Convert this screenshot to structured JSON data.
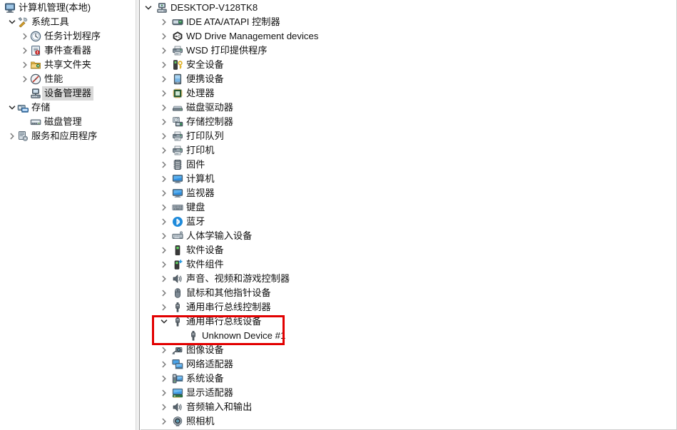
{
  "window": {
    "app": "计算机管理",
    "left_panel_name": "console-tree",
    "right_panel_name": "device-manager-tree"
  },
  "console_tree": {
    "items": [
      {
        "label": "计算机管理(本地)",
        "icon": "computer-management-icon",
        "depth": 0,
        "expander": "none",
        "selected": false
      },
      {
        "label": "系统工具",
        "icon": "system-tools-icon",
        "depth": 1,
        "expander": "expanded",
        "selected": false
      },
      {
        "label": "任务计划程序",
        "icon": "task-scheduler-clock-icon",
        "depth": 2,
        "expander": "collapsed",
        "selected": false
      },
      {
        "label": "事件查看器",
        "icon": "event-viewer-icon",
        "depth": 2,
        "expander": "collapsed",
        "selected": false
      },
      {
        "label": "共享文件夹",
        "icon": "shared-folders-icon",
        "depth": 2,
        "expander": "collapsed",
        "selected": false
      },
      {
        "label": "性能",
        "icon": "performance-gauge-icon",
        "depth": 2,
        "expander": "collapsed",
        "selected": false
      },
      {
        "label": "设备管理器",
        "icon": "device-manager-icon",
        "depth": 2,
        "expander": "none",
        "selected": true
      },
      {
        "label": "存储",
        "icon": "storage-icon",
        "depth": 1,
        "expander": "expanded",
        "selected": false
      },
      {
        "label": "磁盘管理",
        "icon": "disk-management-icon",
        "depth": 2,
        "expander": "none",
        "selected": false
      },
      {
        "label": "服务和应用程序",
        "icon": "services-and-applications-icon",
        "depth": 1,
        "expander": "collapsed",
        "selected": false
      }
    ]
  },
  "device_tree": {
    "items": [
      {
        "label": "DESKTOP-V128TK8",
        "icon": "computer-root-icon",
        "depth": 0,
        "expander": "expanded",
        "latin": true
      },
      {
        "label": "IDE ATA/ATAPI 控制器",
        "icon": "ide-controller-icon",
        "depth": 1,
        "expander": "collapsed"
      },
      {
        "label": "WD Drive Management devices",
        "icon": "wd-drive-management-icon",
        "depth": 1,
        "expander": "collapsed",
        "latin": true
      },
      {
        "label": "WSD 打印提供程序",
        "icon": "printer-icon",
        "depth": 1,
        "expander": "collapsed"
      },
      {
        "label": "安全设备",
        "icon": "security-device-key-icon",
        "depth": 1,
        "expander": "collapsed"
      },
      {
        "label": "便携设备",
        "icon": "portable-device-icon",
        "depth": 1,
        "expander": "collapsed"
      },
      {
        "label": "处理器",
        "icon": "processor-chip-icon",
        "depth": 1,
        "expander": "collapsed"
      },
      {
        "label": "磁盘驱动器",
        "icon": "disk-drive-icon",
        "depth": 1,
        "expander": "collapsed"
      },
      {
        "label": "存储控制器",
        "icon": "storage-controller-icon",
        "depth": 1,
        "expander": "collapsed"
      },
      {
        "label": "打印队列",
        "icon": "print-queue-icon",
        "depth": 1,
        "expander": "collapsed"
      },
      {
        "label": "打印机",
        "icon": "printer-icon",
        "depth": 1,
        "expander": "collapsed"
      },
      {
        "label": "固件",
        "icon": "firmware-icon",
        "depth": 1,
        "expander": "collapsed"
      },
      {
        "label": "计算机",
        "icon": "monitor-computer-icon",
        "depth": 1,
        "expander": "collapsed"
      },
      {
        "label": "监视器",
        "icon": "monitor-icon",
        "depth": 1,
        "expander": "collapsed"
      },
      {
        "label": "键盘",
        "icon": "keyboard-icon",
        "depth": 1,
        "expander": "collapsed"
      },
      {
        "label": "蓝牙",
        "icon": "bluetooth-icon",
        "depth": 1,
        "expander": "collapsed"
      },
      {
        "label": "人体学输入设备",
        "icon": "hid-input-device-icon",
        "depth": 1,
        "expander": "collapsed"
      },
      {
        "label": "软件设备",
        "icon": "software-device-icon",
        "depth": 1,
        "expander": "collapsed"
      },
      {
        "label": "软件组件",
        "icon": "software-component-icon",
        "depth": 1,
        "expander": "collapsed"
      },
      {
        "label": "声音、视频和游戏控制器",
        "icon": "sound-video-game-controller-icon",
        "depth": 1,
        "expander": "collapsed"
      },
      {
        "label": "鼠标和其他指针设备",
        "icon": "mouse-icon",
        "depth": 1,
        "expander": "collapsed"
      },
      {
        "label": "通用串行总线控制器",
        "icon": "usb-icon",
        "depth": 1,
        "expander": "collapsed"
      },
      {
        "label": "通用串行总线设备",
        "icon": "usb-icon",
        "depth": 1,
        "expander": "expanded",
        "highlighted": true
      },
      {
        "label": "Unknown Device #1",
        "icon": "usb-icon",
        "depth": 2,
        "expander": "none",
        "highlighted": true,
        "latin": true
      },
      {
        "label": "图像设备",
        "icon": "imaging-device-camera-icon",
        "depth": 1,
        "expander": "collapsed"
      },
      {
        "label": "网络适配器",
        "icon": "network-adapter-icon",
        "depth": 1,
        "expander": "collapsed"
      },
      {
        "label": "系统设备",
        "icon": "system-device-icon",
        "depth": 1,
        "expander": "collapsed"
      },
      {
        "label": "显示适配器",
        "icon": "display-adapter-icon",
        "depth": 1,
        "expander": "collapsed"
      },
      {
        "label": "音频输入和输出",
        "icon": "audio-input-output-icon",
        "depth": 1,
        "expander": "collapsed"
      },
      {
        "label": "照相机",
        "icon": "camera-icon",
        "depth": 1,
        "expander": "collapsed"
      }
    ]
  },
  "annotation": {
    "name": "red-highlight-box",
    "color": "#e20000",
    "covers": [
      "通用串行总线设备",
      "Unknown Device #1"
    ]
  },
  "glyphs": {
    "chevron_collapsed": "❯",
    "chevron_expanded": "❯"
  }
}
